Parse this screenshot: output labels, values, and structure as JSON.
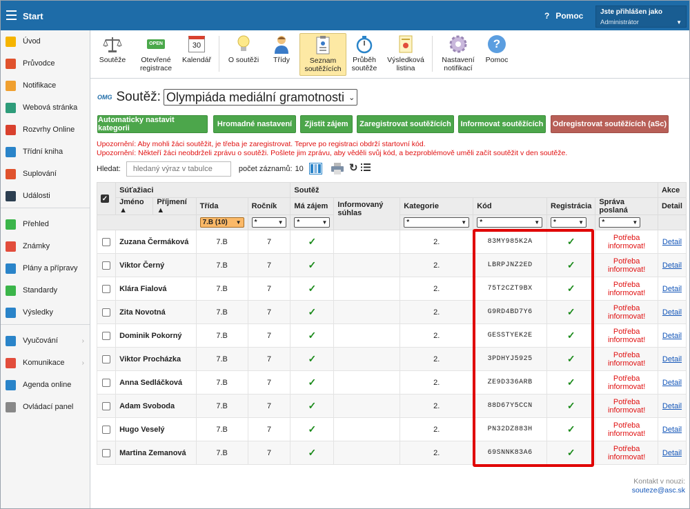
{
  "topbar": {
    "app_title": "Start",
    "help_label": "Pomoc",
    "user_caption": "Jste přihlášen jako",
    "user_role": "Administrátor"
  },
  "sidebar": {
    "items": [
      {
        "label": "Úvod",
        "icon": "star-icon",
        "color": "#f5b400"
      },
      {
        "label": "Průvodce",
        "icon": "wand-icon",
        "color": "#e0522d"
      },
      {
        "label": "Notifikace",
        "icon": "envelope-icon",
        "color": "#f0a030"
      },
      {
        "label": "Webová stránka",
        "icon": "home-icon",
        "color": "#2e9c7a"
      },
      {
        "label": "Rozvrhy Online",
        "icon": "calendar-icon",
        "color": "#d9412e"
      },
      {
        "label": "Třídní kniha",
        "icon": "book-icon",
        "color": "#2a84c9"
      },
      {
        "label": "Suplování",
        "icon": "substitute-icon",
        "color": "#e0522d"
      },
      {
        "label": "Události",
        "icon": "events-icon",
        "color": "#2c3e50"
      },
      {
        "label": "Přehled",
        "icon": "check-circle-icon",
        "color": "#3bb54a"
      },
      {
        "label": "Známky",
        "icon": "grades-icon",
        "color": "#e24d3c"
      },
      {
        "label": "Plány a přípravy",
        "icon": "briefcase-icon",
        "color": "#2a84c9"
      },
      {
        "label": "Standardy",
        "icon": "shield-icon",
        "color": "#3bb54a"
      },
      {
        "label": "Výsledky",
        "icon": "bar-chart-icon",
        "color": "#2a84c9"
      },
      {
        "label": "Vyučování",
        "icon": "teaching-icon",
        "color": "#2a84c9"
      },
      {
        "label": "Komunikace",
        "icon": "chat-icon",
        "color": "#e24d3c"
      },
      {
        "label": "Agenda online",
        "icon": "pen-icon",
        "color": "#2a84c9"
      },
      {
        "label": "Ovládací panel",
        "icon": "gear-icon",
        "color": "#888888"
      }
    ]
  },
  "toolbar": {
    "items": [
      {
        "line1": "Soutěže",
        "line2": ""
      },
      {
        "line1": "Otevřené",
        "line2": "registrace"
      },
      {
        "line1": "Kalendář",
        "line2": ""
      },
      {
        "line1": "O soutěži",
        "line2": ""
      },
      {
        "line1": "Třídy",
        "line2": ""
      },
      {
        "line1": "Seznam",
        "line2": "soutěžících"
      },
      {
        "line1": "Průběh",
        "line2": "soutěže"
      },
      {
        "line1": "Výsledková",
        "line2": "listina"
      },
      {
        "line1": "Nastavení",
        "line2": "notifikací"
      },
      {
        "line1": "Pomoc",
        "line2": ""
      }
    ],
    "open_badge": "OPEN",
    "calendar_day": "30"
  },
  "page": {
    "logo_text": "OMG",
    "heading_label": "Soutěž:",
    "competition": "Olympiáda mediální gramotnosti"
  },
  "actions": {
    "auto_category": "Automaticky nastavit kategorii",
    "bulk_settings": "Hromadné nastavení",
    "find_interest": "Zjistit zájem",
    "register": "Zaregistrovat soutěžících",
    "inform": "Informovat soutěžících",
    "unregister": "Odregistrovat soutěžících (aSc)"
  },
  "warnings": {
    "line1": "Upozornění: Aby mohli žáci soutěžit, je třeba je zaregistrovat. Teprve po registraci obdrží startovní kód.",
    "line2": "Upozornění: Někteří žáci neobdrželi zprávu o soutěži. Pošlete jim zprávu, aby věděli svůj kód, a bezproblémově uměli začít soutěžit v den soutěže."
  },
  "search": {
    "label": "Hledat:",
    "placeholder": "hledaný výraz v tabulce",
    "count_label": "počet záznamů:",
    "count_value": "10"
  },
  "table": {
    "group_students": "Súťažiaci",
    "group_competition": "Soutěž",
    "group_actions": "Akce",
    "col_first": "Jméno",
    "col_last": "Příjmení",
    "col_class": "Třída",
    "col_year": "Ročník",
    "col_interest": "Má zájem",
    "col_consent_1": "Informovaný",
    "col_consent_2": "súhlas",
    "col_category": "Kategorie",
    "col_code": "Kód",
    "col_registration": "Registrácia",
    "col_message": "Správa poslaná",
    "col_detail": "Detail",
    "filter_class": "7.B (10)",
    "filter_any": "*",
    "rows": [
      {
        "name": "Zuzana Čermáková",
        "class": "7.B",
        "year": "7",
        "interest": "✓",
        "category": "2.",
        "code": "83MY985K2A",
        "registered": "✓",
        "msg1": "Potřeba",
        "msg2": "informovat!",
        "detail": "Detail"
      },
      {
        "name": "Viktor Černý",
        "class": "7.B",
        "year": "7",
        "interest": "✓",
        "category": "2.",
        "code": "LBRPJNZ2ED",
        "registered": "✓",
        "msg1": "Potřeba",
        "msg2": "informovat!",
        "detail": "Detail"
      },
      {
        "name": "Klára Fialová",
        "class": "7.B",
        "year": "7",
        "interest": "✓",
        "category": "2.",
        "code": "75T2CZT9BX",
        "registered": "✓",
        "msg1": "Potřeba",
        "msg2": "informovat!",
        "detail": "Detail"
      },
      {
        "name": "Zita Novotná",
        "class": "7.B",
        "year": "7",
        "interest": "✓",
        "category": "2.",
        "code": "G9RD4BD7Y6",
        "registered": "✓",
        "msg1": "Potřeba",
        "msg2": "informovat!",
        "detail": "Detail"
      },
      {
        "name": "Dominik Pokorný",
        "class": "7.B",
        "year": "7",
        "interest": "✓",
        "category": "2.",
        "code": "GESSTYEK2E",
        "registered": "✓",
        "msg1": "Potřeba",
        "msg2": "informovat!",
        "detail": "Detail"
      },
      {
        "name": "Viktor Procházka",
        "class": "7.B",
        "year": "7",
        "interest": "✓",
        "category": "2.",
        "code": "3PDHYJ5925",
        "registered": "✓",
        "msg1": "Potřeba",
        "msg2": "informovat!",
        "detail": "Detail"
      },
      {
        "name": "Anna Sedláčková",
        "class": "7.B",
        "year": "7",
        "interest": "✓",
        "category": "2.",
        "code": "ZE9D336ARB",
        "registered": "✓",
        "msg1": "Potřeba",
        "msg2": "informovat!",
        "detail": "Detail"
      },
      {
        "name": "Adam Svoboda",
        "class": "7.B",
        "year": "7",
        "interest": "✓",
        "category": "2.",
        "code": "88D67Y5CCN",
        "registered": "✓",
        "msg1": "Potřeba",
        "msg2": "informovat!",
        "detail": "Detail"
      },
      {
        "name": "Hugo Veselý",
        "class": "7.B",
        "year": "7",
        "interest": "✓",
        "category": "2.",
        "code": "PN32DZ883H",
        "registered": "✓",
        "msg1": "Potřeba",
        "msg2": "informovat!",
        "detail": "Detail"
      },
      {
        "name": "Martina Zemanová",
        "class": "7.B",
        "year": "7",
        "interest": "✓",
        "category": "2.",
        "code": "69SNNK83A6",
        "registered": "✓",
        "msg1": "Potřeba",
        "msg2": "informovat!",
        "detail": "Detail"
      }
    ]
  },
  "contact": {
    "label": "Kontakt v nouzi:",
    "email": "souteze@asc.sk"
  },
  "colors": {
    "topbar": "#1e6ca8",
    "green_button": "#4ca64b",
    "danger_button": "#b85f57",
    "warning_text": "#e01010",
    "highlight_box": "#e00000"
  }
}
